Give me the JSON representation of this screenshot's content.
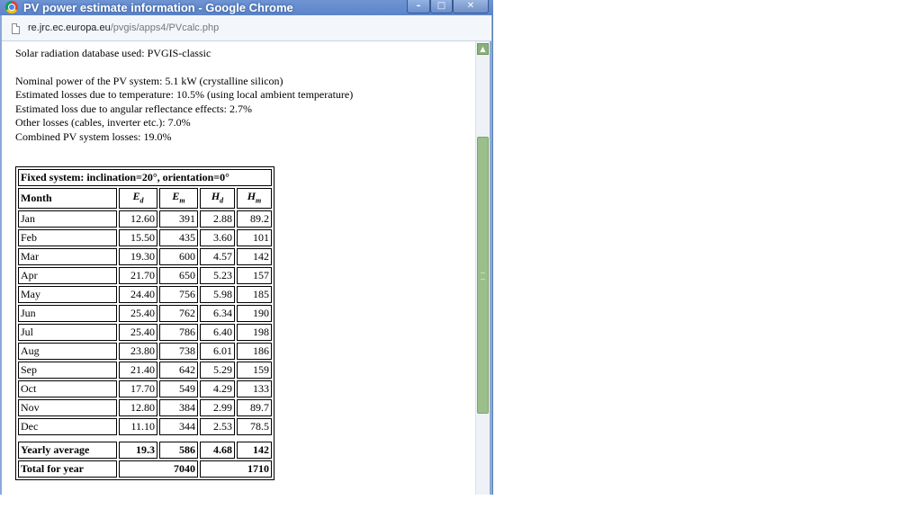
{
  "window": {
    "title": "PV power estimate information - Google Chrome"
  },
  "address": {
    "host": "re.jrc.ec.europa.eu",
    "path": "/pvgis/apps4/PVcalc.php"
  },
  "info": {
    "database": "Solar radiation database used: PVGIS-classic",
    "lines": [
      "Nominal power of the PV system: 5.1 kW (crystalline silicon)",
      "Estimated losses due to temperature: 10.5% (using local ambient temperature)",
      "Estimated loss due to angular reflectance effects: 2.7%",
      "Other losses (cables, inverter etc.): 7.0%",
      "Combined PV system losses: 19.0%"
    ]
  },
  "table": {
    "caption": "Fixed system: inclination=20°, orientation=0°",
    "headers": {
      "month": "Month",
      "ed": "E",
      "ed_sub": "d",
      "em": "E",
      "em_sub": "m",
      "hd": "H",
      "hd_sub": "d",
      "hm": "H",
      "hm_sub": "m"
    },
    "rows": [
      {
        "month": "Jan",
        "ed": "12.60",
        "em": "391",
        "hd": "2.88",
        "hm": "89.2"
      },
      {
        "month": "Feb",
        "ed": "15.50",
        "em": "435",
        "hd": "3.60",
        "hm": "101"
      },
      {
        "month": "Mar",
        "ed": "19.30",
        "em": "600",
        "hd": "4.57",
        "hm": "142"
      },
      {
        "month": "Apr",
        "ed": "21.70",
        "em": "650",
        "hd": "5.23",
        "hm": "157"
      },
      {
        "month": "May",
        "ed": "24.40",
        "em": "756",
        "hd": "5.98",
        "hm": "185"
      },
      {
        "month": "Jun",
        "ed": "25.40",
        "em": "762",
        "hd": "6.34",
        "hm": "190"
      },
      {
        "month": "Jul",
        "ed": "25.40",
        "em": "786",
        "hd": "6.40",
        "hm": "198"
      },
      {
        "month": "Aug",
        "ed": "23.80",
        "em": "738",
        "hd": "6.01",
        "hm": "186"
      },
      {
        "month": "Sep",
        "ed": "21.40",
        "em": "642",
        "hd": "5.29",
        "hm": "159"
      },
      {
        "month": "Oct",
        "ed": "17.70",
        "em": "549",
        "hd": "4.29",
        "hm": "133"
      },
      {
        "month": "Nov",
        "ed": "12.80",
        "em": "384",
        "hd": "2.99",
        "hm": "89.7"
      },
      {
        "month": "Dec",
        "ed": "11.10",
        "em": "344",
        "hd": "2.53",
        "hm": "78.5"
      }
    ],
    "yearly_average": {
      "label": "Yearly average",
      "ed": "19.3",
      "em": "586",
      "hd": "4.68",
      "hm": "142"
    },
    "total": {
      "label": "Total for year",
      "em": "7040",
      "hm": "1710"
    }
  }
}
